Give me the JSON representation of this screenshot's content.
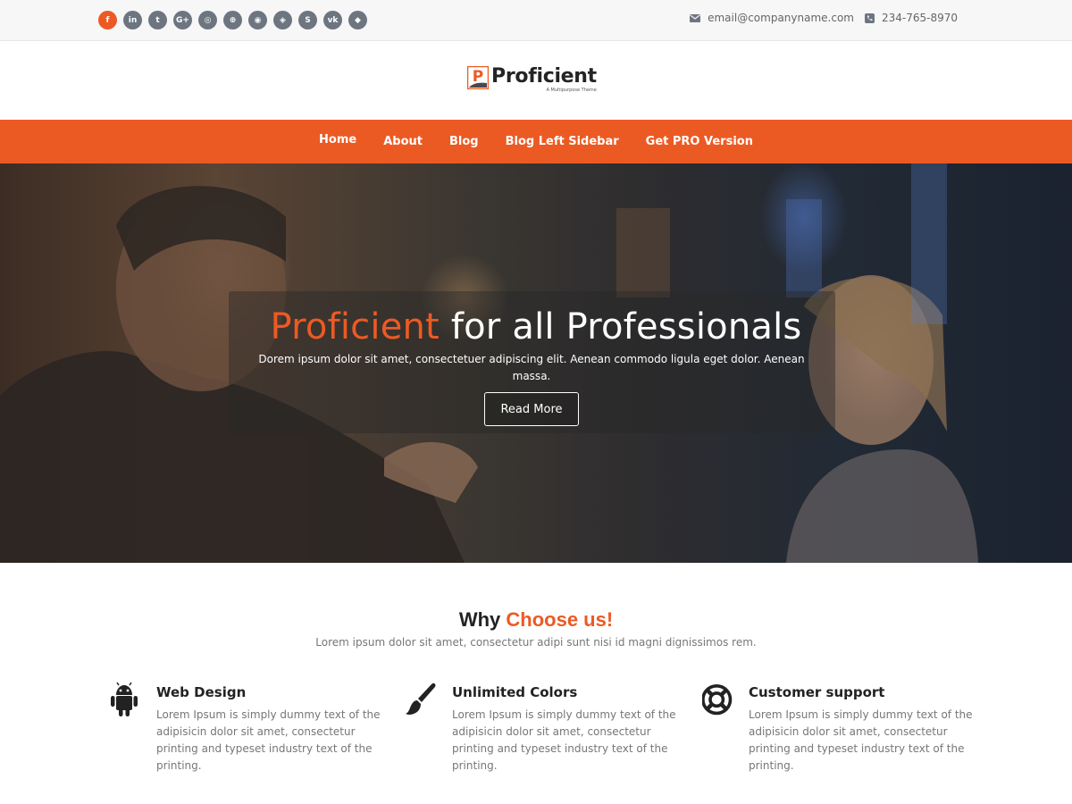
{
  "topbar": {
    "socials": [
      {
        "icon": "facebook-icon",
        "glyph": "f"
      },
      {
        "icon": "linkedin-icon",
        "glyph": "in"
      },
      {
        "icon": "twitter-icon",
        "glyph": "t"
      },
      {
        "icon": "google-plus-icon",
        "glyph": "G+"
      },
      {
        "icon": "instagram-icon",
        "glyph": "◎"
      },
      {
        "icon": "dribbble-icon",
        "glyph": "⊕"
      },
      {
        "icon": "github-icon",
        "glyph": "◉"
      },
      {
        "icon": "stumbleupon-icon",
        "glyph": "◈"
      },
      {
        "icon": "skype-icon",
        "glyph": "S"
      },
      {
        "icon": "vk-icon",
        "glyph": "vk"
      },
      {
        "icon": "foursquare-icon",
        "glyph": "◆"
      }
    ],
    "email": "email@companyname.com",
    "phone": "234-765-8970"
  },
  "logo": {
    "name": "Proficient",
    "mark_letter": "P",
    "tagline": "A Multipurpose Theme"
  },
  "nav": {
    "items": [
      "Home",
      "About",
      "Blog",
      "Blog Left Sidebar",
      "Get PRO Version"
    ]
  },
  "hero": {
    "title_accent": "Proficient",
    "title_rest": " for all Professionals",
    "subtitle": "Dorem ipsum dolor sit amet, consectetuer adipiscing elit. Aenean commodo ligula eget dolor. Aenean massa.",
    "button": "Read More"
  },
  "why": {
    "title_plain": "Why ",
    "title_accent": "Choose us!",
    "subtitle": "Lorem ipsum dolor sit amet, consectetur adipi sunt nisi id magni dignissimos rem.",
    "features": [
      {
        "icon": "android-icon",
        "title": "Web Design",
        "text": "Lorem Ipsum is simply dummy text of the adipisicin dolor sit amet, consectetur printing and typeset industry text of the printing."
      },
      {
        "icon": "paint-brush-icon",
        "title": "Unlimited Colors",
        "text": "Lorem Ipsum is simply dummy text of the adipisicin dolor sit amet, consectetur printing and typeset industry text of the printing."
      },
      {
        "icon": "life-ring-icon",
        "title": "Customer support",
        "text": "Lorem Ipsum is simply dummy text of the adipisicin dolor sit amet, consectetur printing and typeset industry text of the printing."
      }
    ]
  },
  "colors": {
    "accent": "#ec5a24",
    "social_gray": "#6d7580",
    "dark_icon": "#222222"
  }
}
